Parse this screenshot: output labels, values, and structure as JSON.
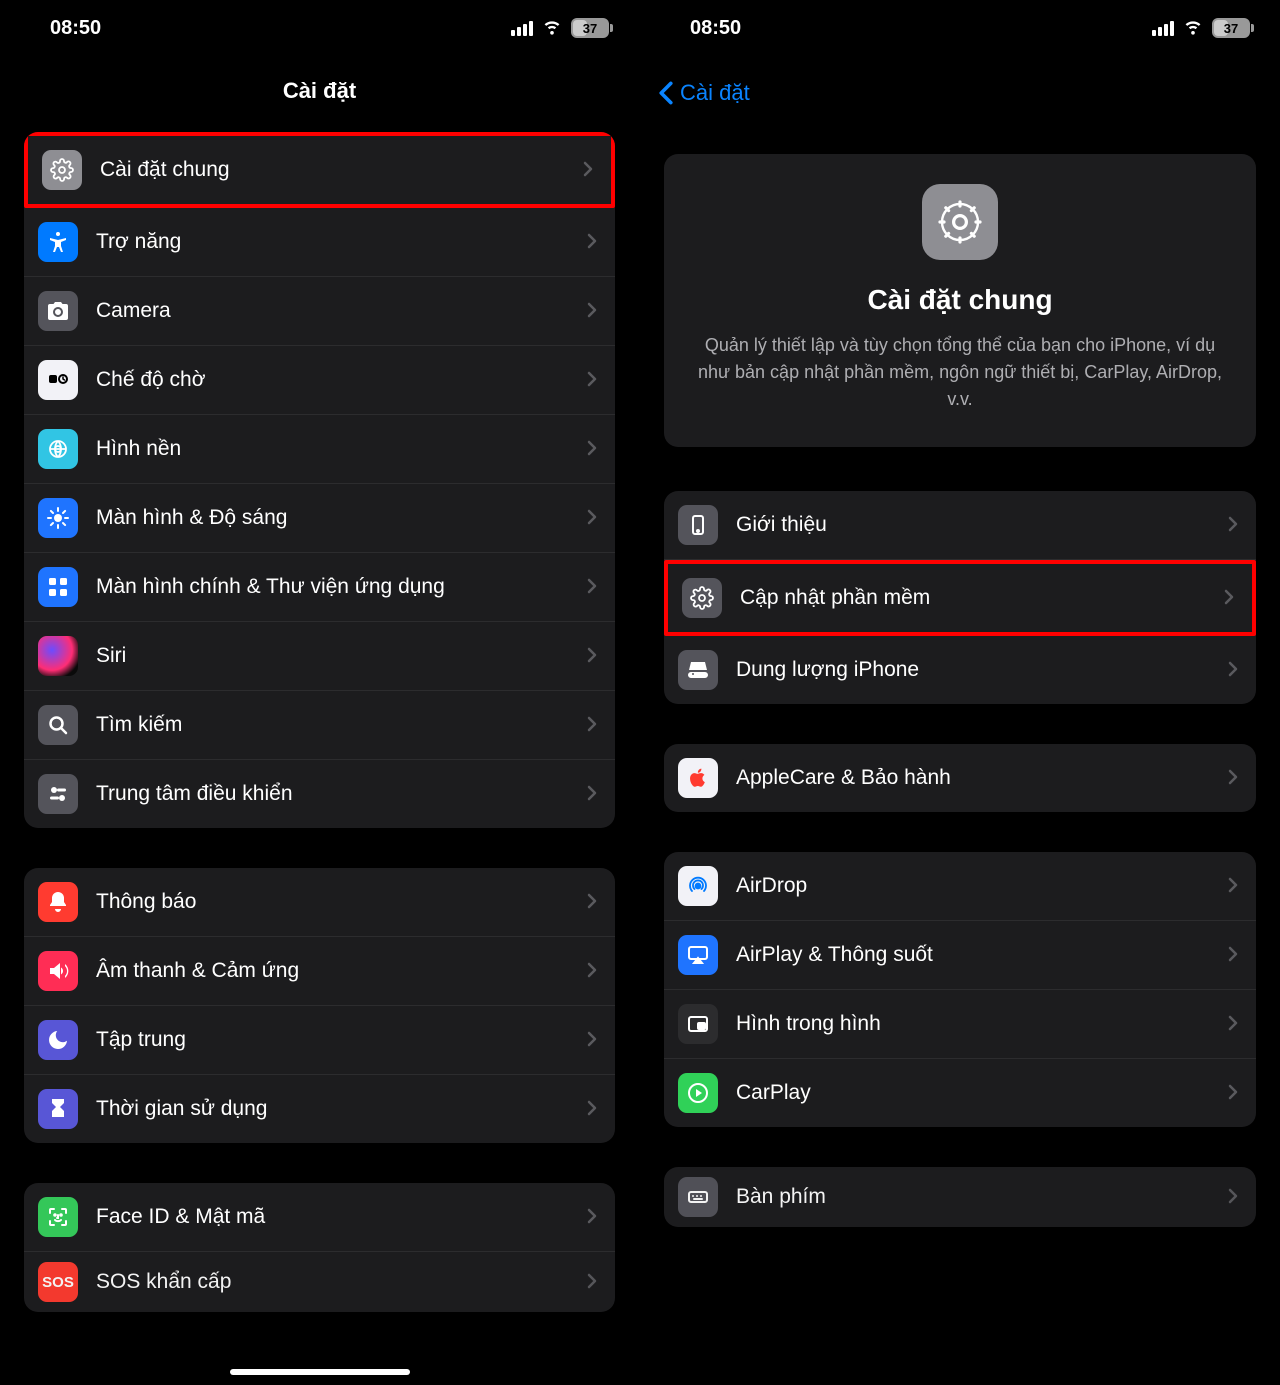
{
  "status": {
    "time": "08:50",
    "battery": "37"
  },
  "left": {
    "title": "Cài đặt",
    "groups": [
      [
        {
          "id": "general",
          "label": "Cài đặt chung",
          "highlight": true,
          "icon": "gear",
          "bg": "bg-gray"
        },
        {
          "id": "accessibility",
          "label": "Trợ năng",
          "icon": "accessibility",
          "bg": "bg-blue"
        },
        {
          "id": "camera",
          "label": "Camera",
          "icon": "camera",
          "bg": "bg-lgray"
        },
        {
          "id": "standby",
          "label": "Chế độ chờ",
          "icon": "standby",
          "bg": "bg-white",
          "fg": "#000"
        },
        {
          "id": "wallpaper",
          "label": "Hình nền",
          "icon": "wallpaper",
          "bg": "bg-teal"
        },
        {
          "id": "display",
          "label": "Màn hình & Độ sáng",
          "icon": "brightness",
          "bg": "bg-dblue"
        },
        {
          "id": "homescreen",
          "label": "Màn hình chính & Thư viện ứng dụng",
          "icon": "apps",
          "bg": "bg-dblue"
        },
        {
          "id": "siri",
          "label": "Siri",
          "icon": "siri",
          "bg": "siri-icon"
        },
        {
          "id": "search",
          "label": "Tìm kiếm",
          "icon": "search",
          "bg": "bg-lgray"
        },
        {
          "id": "controlcenter",
          "label": "Trung tâm điều khiển",
          "icon": "sliders",
          "bg": "bg-lgray"
        }
      ],
      [
        {
          "id": "notifications",
          "label": "Thông báo",
          "icon": "bell",
          "bg": "bg-red"
        },
        {
          "id": "sounds",
          "label": "Âm thanh & Cảm ứng",
          "icon": "speaker",
          "bg": "bg-pink"
        },
        {
          "id": "focus",
          "label": "Tập trung",
          "icon": "moon",
          "bg": "bg-indigo"
        },
        {
          "id": "screentime",
          "label": "Thời gian sử dụng",
          "icon": "hourglass",
          "bg": "bg-indigo"
        }
      ],
      [
        {
          "id": "faceid",
          "label": "Face ID & Mật mã",
          "icon": "faceid",
          "bg": "bg-green"
        },
        {
          "id": "sos",
          "label": "SOS khẩn cấp",
          "icon": "sos",
          "bg": "bg-dr",
          "partial": true
        }
      ]
    ]
  },
  "right": {
    "back_label": "Cài đặt",
    "hero": {
      "title": "Cài đặt chung",
      "desc": "Quản lý thiết lập và tùy chọn tổng thể của bạn cho iPhone, ví dụ như bản cập nhật phần mềm, ngôn ngữ thiết bị, CarPlay, AirDrop, v.v."
    },
    "groups": [
      [
        {
          "id": "about",
          "label": "Giới thiệu",
          "icon": "phone-portrait",
          "bg": "bg-lgray"
        },
        {
          "id": "software-update",
          "label": "Cập nhật phần mềm",
          "highlight": true,
          "icon": "gear",
          "bg": "bg-lgray"
        },
        {
          "id": "storage",
          "label": "Dung lượng iPhone",
          "icon": "storage",
          "bg": "bg-lgray"
        }
      ],
      [
        {
          "id": "applecare",
          "label": "AppleCare & Bảo hành",
          "icon": "apple",
          "bg": "bg-white",
          "fg": "#ff3b30"
        }
      ],
      [
        {
          "id": "airdrop",
          "label": "AirDrop",
          "icon": "airdrop",
          "bg": "bg-white",
          "fg": "#007aff"
        },
        {
          "id": "airplay",
          "label": "AirPlay & Thông suốt",
          "icon": "airplay",
          "bg": "bg-dblue"
        },
        {
          "id": "pip",
          "label": "Hình trong hình",
          "icon": "pip",
          "bg": "bg-darkg"
        },
        {
          "id": "carplay",
          "label": "CarPlay",
          "icon": "carplay",
          "bg": "bg-dgreen"
        }
      ],
      [
        {
          "id": "keyboard",
          "label": "Bàn phím",
          "icon": "keyboard",
          "bg": "bg-lgray",
          "partial": true
        }
      ]
    ]
  }
}
